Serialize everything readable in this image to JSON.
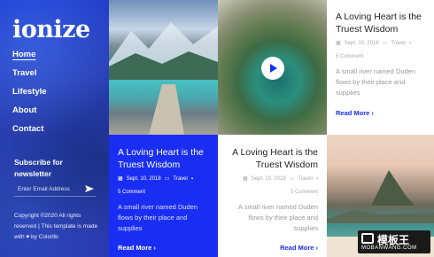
{
  "brand": {
    "logo": "ionize"
  },
  "nav": {
    "items": [
      "Home",
      "Travel",
      "Lifestyle",
      "About",
      "Contact"
    ],
    "active": "Home"
  },
  "newsletter": {
    "title": "Subscribe for newsletter",
    "placeholder": "Enter Email Address"
  },
  "footer": {
    "copyright": "Copyright ©2020 All rights reserved | This template is made with ♥ by Colorlib"
  },
  "posts": [
    {
      "title": "A Loving Heart is the Truest Wisdom",
      "date": "Sept. 10, 2018",
      "category": "Travel",
      "comments": "5 Comment",
      "excerpt": "A small river named Duden flows by their place and supplies",
      "read_more": "Read More ›"
    },
    {
      "title": "A Loving Heart is the Truest Wisdom",
      "date": "Sept. 10, 2018",
      "category": "Travel",
      "comments": "5 Comment",
      "excerpt": "A small river named Duden flows by their place and supplies",
      "read_more": "Read More ›"
    },
    {
      "title": "A Loving Heart is the Truest Wisdom",
      "date": "Sept. 10, 2018",
      "category": "Travel",
      "comments": "5 Comment",
      "excerpt": "A small river named Duden flows by their place and supplies",
      "read_more": "Read More ›"
    }
  ],
  "watermark": {
    "big": "模板王",
    "small": "MOBANWANG.COM"
  },
  "colors": {
    "accent": "#1a2ef3",
    "sidebar": "#2a3fb9"
  }
}
